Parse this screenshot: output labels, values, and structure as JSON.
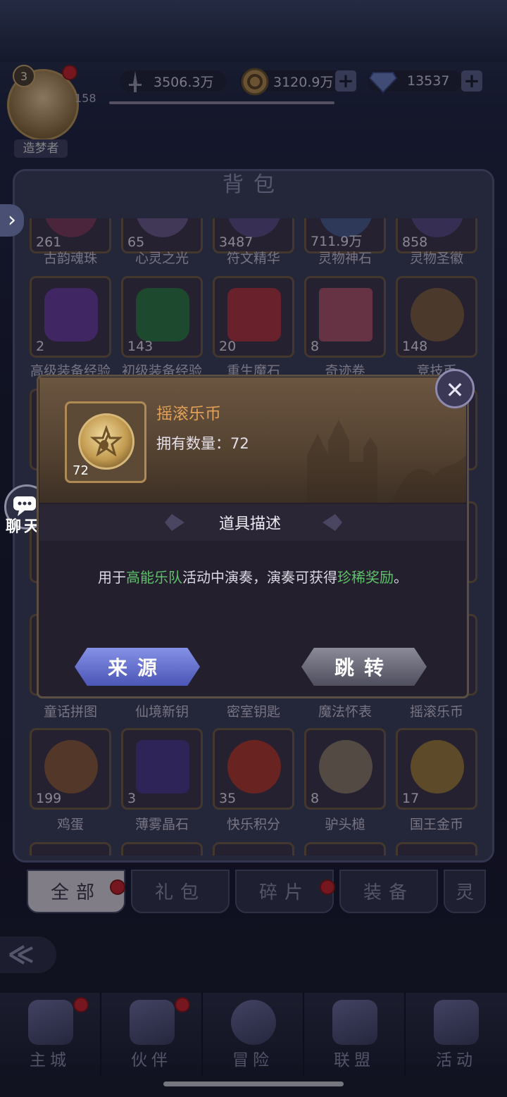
{
  "header": {
    "avatar_level": "3",
    "avatar_name": "造梦者",
    "side_number": "158",
    "power": "3506.3万",
    "gold": "3120.9万",
    "diamonds": "13537"
  },
  "bag": {
    "title": "背包",
    "rows": [
      {
        "items": [
          {
            "count": "261",
            "label": "古韵魂珠",
            "color": "#7b3b5c"
          },
          {
            "count": "65",
            "label": "心灵之光",
            "color": "#6b5a8a"
          },
          {
            "count": "3487",
            "label": "符文精华",
            "color": "#5c4e86"
          },
          {
            "count": "711.9万",
            "label": "灵物神石",
            "color": "#4b5e8e"
          },
          {
            "count": "858",
            "label": "灵物圣徽",
            "color": "#5b4a86"
          }
        ]
      },
      {
        "items": [
          {
            "count": "2",
            "label": "高级装备经验",
            "color": "#6a3ea0"
          },
          {
            "count": "143",
            "label": "初级装备经验",
            "color": "#2e7a44"
          },
          {
            "count": "20",
            "label": "重生魔石",
            "color": "#b0343f"
          },
          {
            "count": "8",
            "label": "奇迹卷",
            "color": "#a9546a"
          },
          {
            "count": "148",
            "label": "竞技币",
            "color": "#7c6040"
          }
        ]
      },
      {
        "items": [
          {
            "count": "",
            "label": "童话拼图",
            "color": "#5a5070"
          },
          {
            "count": "",
            "label": "仙境新钥",
            "color": "#5a5070"
          },
          {
            "count": "",
            "label": "密室钥匙",
            "color": "#5a5070"
          },
          {
            "count": "",
            "label": "魔法怀表",
            "color": "#5a5070"
          },
          {
            "count": "",
            "label": "摇滚乐币",
            "color": "#5a5070"
          }
        ]
      },
      {
        "items": [
          {
            "count": "199",
            "label": "鸡蛋",
            "color": "#8a5a3a"
          },
          {
            "count": "3",
            "label": "薄雾晶石",
            "color": "#4a3a8c"
          },
          {
            "count": "35",
            "label": "快乐积分",
            "color": "#b03a2e"
          },
          {
            "count": "8",
            "label": "驴头槌",
            "color": "#8a7a6a"
          },
          {
            "count": "17",
            "label": "国王金币",
            "color": "#9a7a3a"
          }
        ]
      }
    ],
    "tabs": [
      "全部",
      "礼包",
      "碎片",
      "装备",
      "灵"
    ]
  },
  "popup": {
    "item_name": "摇滚乐币",
    "own_label": "拥有数量：",
    "own_value": "72",
    "item_count": "72",
    "desc_title": "道具描述",
    "desc_parts": [
      "用于",
      "高能乐队",
      "活动中演奏，演奏可获得",
      "珍稀奖励",
      "。"
    ],
    "btn_source": "来源",
    "btn_jump": "跳转"
  },
  "side": {
    "chat_label": "聊天"
  },
  "nav": {
    "items": [
      {
        "label": "主城",
        "icon": "castle-icon"
      },
      {
        "label": "伙伴",
        "icon": "hat-icon"
      },
      {
        "label": "冒险",
        "icon": "compass-icon"
      },
      {
        "label": "联盟",
        "icon": "shield-icon"
      },
      {
        "label": "活动",
        "icon": "cards-icon"
      }
    ]
  },
  "colors": {
    "highlight": "#5fc26a",
    "item_name": "#e2a057"
  }
}
